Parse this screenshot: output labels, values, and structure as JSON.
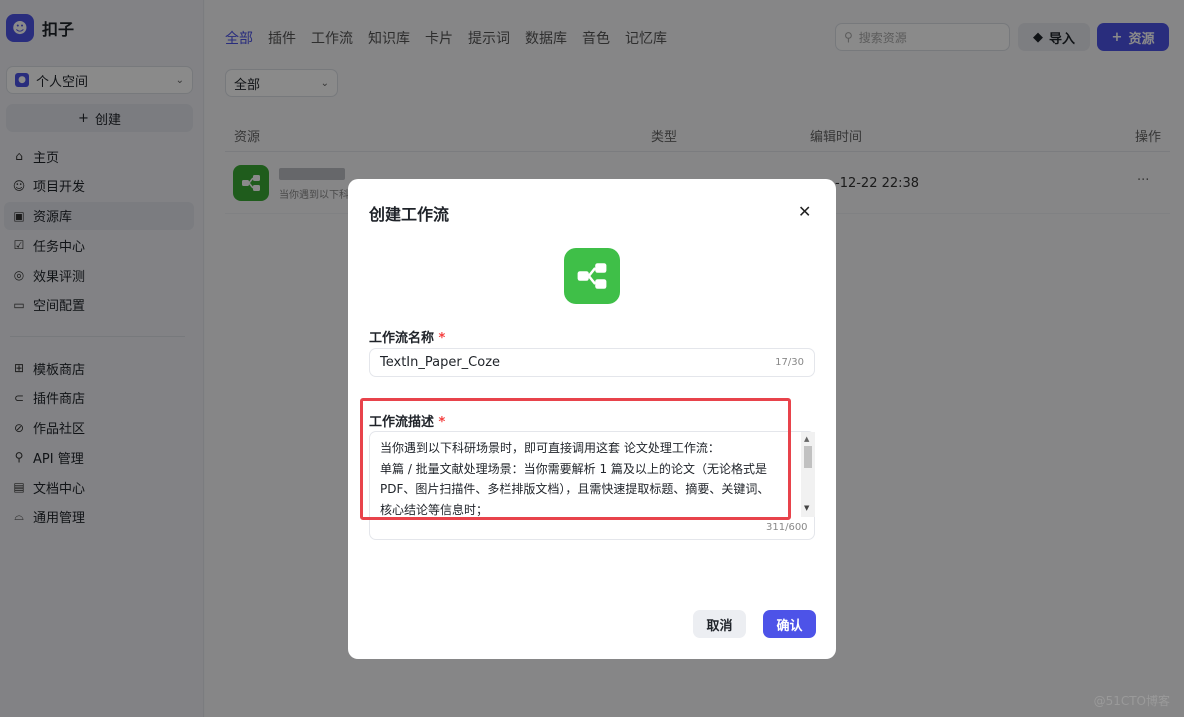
{
  "app": {
    "name": "扣子"
  },
  "sidebar": {
    "space_label": "个人空间",
    "create_label": "创建",
    "nav_primary": [
      {
        "label": "主页",
        "icon": "home-icon"
      },
      {
        "label": "项目开发",
        "icon": "project-icon"
      },
      {
        "label": "资源库",
        "icon": "library-icon",
        "active": true
      },
      {
        "label": "任务中心",
        "icon": "task-icon"
      },
      {
        "label": "效果评测",
        "icon": "evaluation-icon"
      },
      {
        "label": "空间配置",
        "icon": "config-icon"
      }
    ],
    "nav_secondary": [
      {
        "label": "模板商店",
        "icon": "template-icon"
      },
      {
        "label": "插件商店",
        "icon": "plugin-icon"
      },
      {
        "label": "作品社区",
        "icon": "community-icon"
      },
      {
        "label": "API 管理",
        "icon": "api-icon"
      },
      {
        "label": "文档中心",
        "icon": "doc-icon"
      },
      {
        "label": "通用管理",
        "icon": "manage-icon"
      }
    ]
  },
  "main": {
    "tabs": [
      "全部",
      "插件",
      "工作流",
      "知识库",
      "卡片",
      "提示词",
      "数据库",
      "音色",
      "记忆库"
    ],
    "search_placeholder": "搜索资源",
    "import_label": "导入",
    "resource_button_label": "资源",
    "filter_value": "全部",
    "columns": {
      "resource": "资源",
      "type": "类型",
      "edited": "编辑时间",
      "actions": "操作"
    },
    "row": {
      "desc": "当你遇到以下科",
      "time": "-12-22 22:38",
      "more": "···"
    }
  },
  "modal": {
    "title": "创建工作流",
    "name_label": "工作流名称",
    "name_value": "TextIn_Paper_Coze",
    "name_counter": "17/30",
    "desc_label": "工作流描述",
    "desc_lines": [
      "当你遇到以下科研场景时，即可直接调用这套 论文处理工作流：",
      "单篇 / 批量文献处理场景：当你需要解析 1 篇及以上的论文（无论格式是",
      "PDF、图片扫描件、多栏排版文档），且需快速提取标题、摘要、关键词、",
      "核心结论等信息时；"
    ],
    "desc_counter": "311/600",
    "required_mark": "*",
    "cancel_label": "取消",
    "ok_label": "确认"
  },
  "colors": {
    "accent": "#4d53e8",
    "workflow_green": "#3fbf48",
    "highlight_red": "#e8434b"
  },
  "watermark": "@51CTO博客"
}
